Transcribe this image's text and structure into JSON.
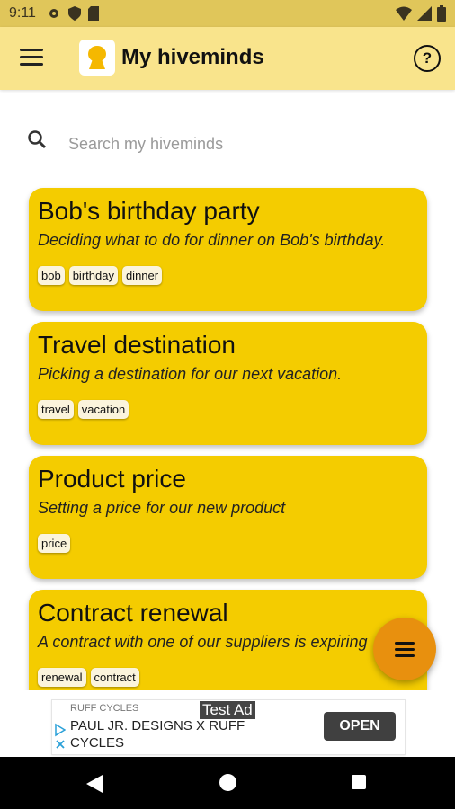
{
  "status_bar": {
    "time": "9:11"
  },
  "app_bar": {
    "title": "My hiveminds"
  },
  "search": {
    "placeholder": "Search my hiveminds",
    "value": ""
  },
  "cards": [
    {
      "title": "Bob's birthday party",
      "description": "Deciding what to do for dinner on Bob's birthday.",
      "tags": [
        "bob",
        "birthday",
        "dinner"
      ]
    },
    {
      "title": "Travel destination",
      "description": "Picking a destination for our next vacation.",
      "tags": [
        "travel",
        "vacation"
      ]
    },
    {
      "title": "Product price",
      "description": "Setting a price for our new product",
      "tags": [
        "price"
      ]
    },
    {
      "title": "Contract renewal",
      "description": "A contract with one of our suppliers is expiring",
      "tags": [
        "renewal",
        "contract"
      ]
    }
  ],
  "ad": {
    "brand": "RUFF CYCLES",
    "test_label": "Test Ad",
    "headline": "PAUL JR. DESIGNS X RUFF CYCLES",
    "button": "OPEN"
  },
  "colors": {
    "app_bar": "#f9e48c",
    "card": "#f4cc00",
    "fab": "#e8900e",
    "status_bar": "#e0c65a"
  },
  "icons": [
    "menu-icon",
    "hivemind-logo-icon",
    "help-icon",
    "search-icon",
    "fab-menu-icon",
    "back-icon",
    "home-icon",
    "recents-icon"
  ]
}
